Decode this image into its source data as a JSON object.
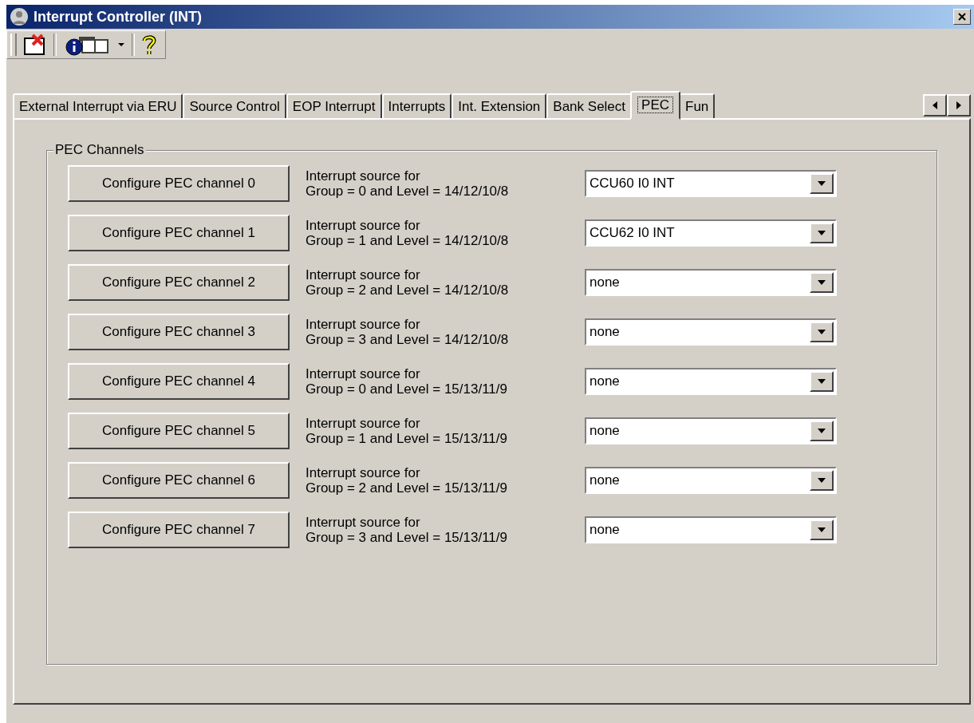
{
  "window": {
    "title": "Interrupt Controller (INT)"
  },
  "tabs": [
    {
      "label": "External Interrupt via ERU",
      "selected": false
    },
    {
      "label": "Source Control",
      "selected": false
    },
    {
      "label": "EOP Interrupt",
      "selected": false
    },
    {
      "label": "Interrupts",
      "selected": false
    },
    {
      "label": "Int. Extension",
      "selected": false
    },
    {
      "label": "Bank Select",
      "selected": false
    },
    {
      "label": "PEC",
      "selected": true
    },
    {
      "label": "Fun",
      "selected": false
    }
  ],
  "group": {
    "title": "PEC Channels"
  },
  "channels": [
    {
      "button": "Configure PEC channel 0",
      "line1": "Interrupt source for",
      "line2": "Group = 0 and Level = 14/12/10/8",
      "value": "CCU60 I0 INT"
    },
    {
      "button": "Configure PEC channel 1",
      "line1": "Interrupt source for",
      "line2": "Group = 1 and Level = 14/12/10/8",
      "value": "CCU62 I0 INT"
    },
    {
      "button": "Configure PEC channel 2",
      "line1": "Interrupt source for",
      "line2": "Group = 2 and Level = 14/12/10/8",
      "value": "none"
    },
    {
      "button": "Configure PEC channel 3",
      "line1": "Interrupt source for",
      "line2": "Group = 3 and Level = 14/12/10/8",
      "value": "none"
    },
    {
      "button": "Configure PEC channel 4",
      "line1": "Interrupt source for",
      "line2": "Group = 0 and Level = 15/13/11/9",
      "value": "none"
    },
    {
      "button": "Configure PEC channel 5",
      "line1": "Interrupt source for",
      "line2": "Group = 1 and Level = 15/13/11/9",
      "value": "none"
    },
    {
      "button": "Configure PEC channel 6",
      "line1": "Interrupt source for",
      "line2": "Group = 2 and Level = 15/13/11/9",
      "value": "none"
    },
    {
      "button": "Configure PEC channel 7",
      "line1": "Interrupt source for",
      "line2": "Group = 3 and Level = 15/13/11/9",
      "value": "none"
    }
  ]
}
